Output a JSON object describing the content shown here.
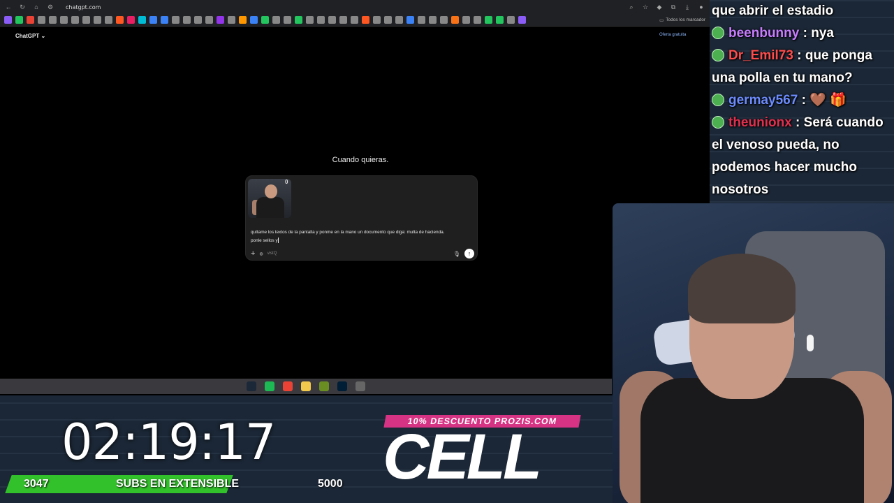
{
  "browser": {
    "url": "chatgpt.com",
    "bookmarks_folder": "Todos los marcador",
    "bookmark_colors": [
      "#8b5cf6",
      "#22c55e",
      "#ea4335",
      "#888",
      "#888",
      "#888",
      "#888",
      "#888",
      "#888",
      "#888",
      "#ff5722",
      "#e91e63",
      "#00bcd4",
      "#3b82f6",
      "#3b82f6",
      "#888",
      "#888",
      "#888",
      "#888",
      "#9333ea",
      "#888",
      "#ff9800",
      "#3b82f6",
      "#22c55e",
      "#888",
      "#888",
      "#22c55e",
      "#888",
      "#888",
      "#888",
      "#888",
      "#888",
      "#ff5722",
      "#888",
      "#888",
      "#888",
      "#3b82f6",
      "#888",
      "#888",
      "#888",
      "#f97316",
      "#888",
      "#888",
      "#22c55e",
      "#22c55e",
      "#888",
      "#8b5cf6"
    ]
  },
  "chatgpt": {
    "app_name": "ChatGPT",
    "offer": "Oferta gratuita",
    "prompt_title": "Cuando quieras.",
    "composer_text_line1": "quítame los textos de la pantalla y ponme en la mano un documento que diga: multa de hacienda.",
    "composer_text_line2": "ponle sellos y",
    "tool_label": "vistQ",
    "thumb_badge": "0"
  },
  "taskbar": {
    "icons": [
      "steam-icon",
      "spotify-icon",
      "chrome-icon",
      "files-icon",
      "app-icon",
      "photoshop-icon",
      "obs-icon"
    ]
  },
  "chat": {
    "lines": [
      {
        "user": "",
        "color": "#ffffff",
        "text": "que abrir el estadio"
      },
      {
        "user": "beenbunny",
        "color": "#c77dff",
        "text": " : nya"
      },
      {
        "user": "Dr_Emil73",
        "color": "#ff4d4d",
        "text": " : que ponga una polla en tu mano?"
      },
      {
        "user": "germay567",
        "color": "#6c8cff",
        "text": " : 🤎 🎁"
      },
      {
        "user": "theunionx",
        "color": "#e0304e",
        "text": " : Será cuando el venoso pueda, no podemos hacer mucho nosotros"
      }
    ]
  },
  "stream": {
    "timer": "02:19:17",
    "subs_current": "3047",
    "subs_label": "SUBS EN EXTENSIBLE",
    "subs_goal": "5000",
    "subs_progress": 0.6094,
    "promo_tag": "10% DESCUENTO PROZIS.COM",
    "promo_logo": "CELL"
  }
}
